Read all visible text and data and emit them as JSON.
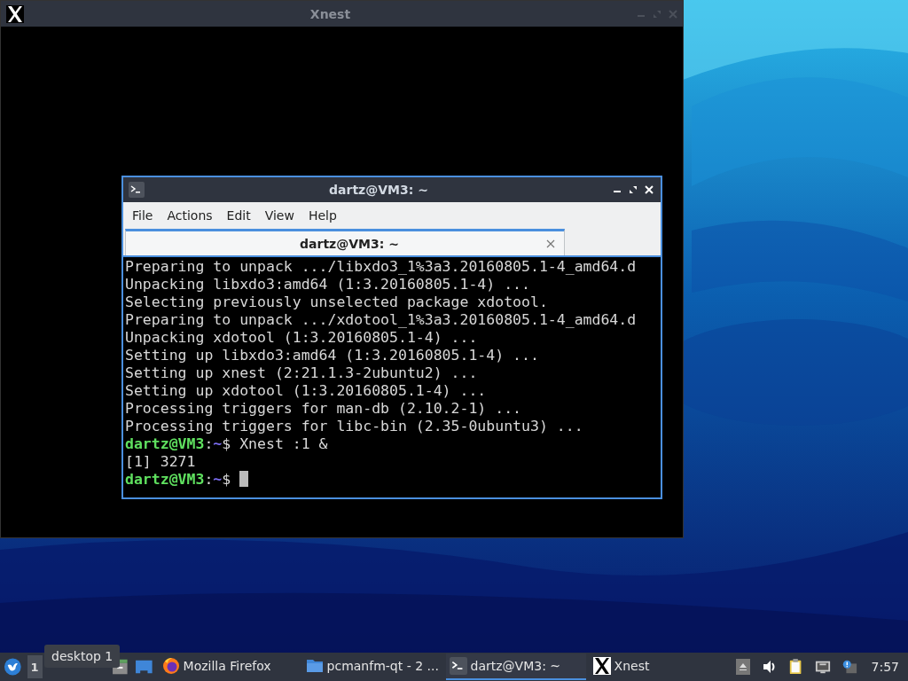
{
  "xnest_window": {
    "title": "Xnest"
  },
  "terminal": {
    "title": "dartz@VM3: ~",
    "menu": [
      "File",
      "Actions",
      "Edit",
      "View",
      "Help"
    ],
    "tabs": [
      {
        "label": "dartz@VM3: ~",
        "selected": true
      }
    ],
    "lines": [
      {
        "kind": "output",
        "text": "Preparing to unpack .../libxdo3_1%3a3.20160805.1-4_amd64.d"
      },
      {
        "kind": "output",
        "text": "Unpacking libxdo3:amd64 (1:3.20160805.1-4) ..."
      },
      {
        "kind": "output",
        "text": "Selecting previously unselected package xdotool."
      },
      {
        "kind": "output",
        "text": "Preparing to unpack .../xdotool_1%3a3.20160805.1-4_amd64.d"
      },
      {
        "kind": "output",
        "text": "Unpacking xdotool (1:3.20160805.1-4) ..."
      },
      {
        "kind": "output",
        "text": "Setting up libxdo3:amd64 (1:3.20160805.1-4) ..."
      },
      {
        "kind": "output",
        "text": "Setting up xnest (2:21.1.3-2ubuntu2) ..."
      },
      {
        "kind": "output",
        "text": "Setting up xdotool (1:3.20160805.1-4) ..."
      },
      {
        "kind": "output",
        "text": "Processing triggers for man-db (2.10.2-1) ..."
      },
      {
        "kind": "output",
        "text": "Processing triggers for libc-bin (2.35-0ubuntu3) ..."
      },
      {
        "kind": "prompt",
        "user": "dartz@VM3",
        "separator": ":",
        "path": "~",
        "symbol": "$",
        "command": "Xnest :1 &"
      },
      {
        "kind": "output",
        "text": "[1] 3271"
      },
      {
        "kind": "prompt",
        "user": "dartz@VM3",
        "separator": ":",
        "path": "~",
        "symbol": "$",
        "cursor": true
      }
    ]
  },
  "taskbar": {
    "desktop_button": "1",
    "tooltip": "desktop 1",
    "tasks": [
      {
        "kind": "firefox",
        "label": "Mozilla Firefox",
        "selected": false
      },
      {
        "kind": "folder",
        "label": "pcmanfm-qt - 2 ...",
        "selected": false
      },
      {
        "kind": "terminal",
        "label": "dartz@VM3: ~",
        "selected": true
      },
      {
        "kind": "x",
        "label": "Xnest",
        "selected": false
      }
    ],
    "clock": "7:57"
  }
}
